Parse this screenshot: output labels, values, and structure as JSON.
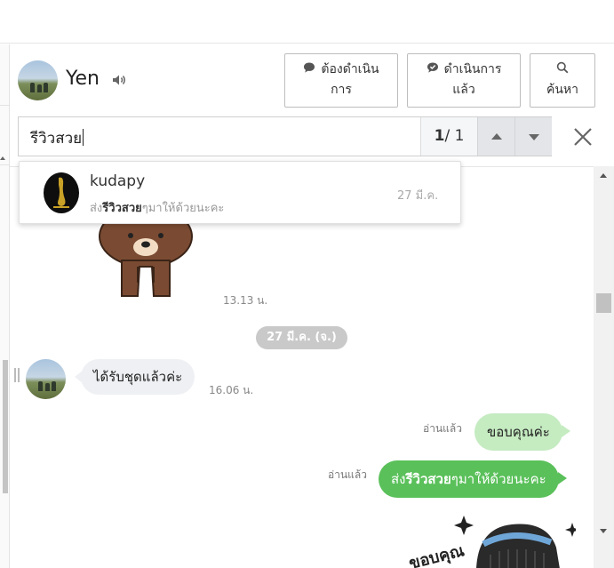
{
  "header": {
    "contact_name": "Yen",
    "buttons": {
      "todo": {
        "line1": "ต้องดำเนิน",
        "line2": "การ"
      },
      "done": {
        "line1": "ดำเนินการ",
        "line2": "แล้ว"
      },
      "search": {
        "line1": "",
        "line2": "ค้นหา"
      }
    }
  },
  "search": {
    "query": "รีวิวสวย",
    "current": "1",
    "total": "/ 1"
  },
  "search_result": {
    "name": "kudapy",
    "snippet_pre": "ส่ง",
    "snippet_match": "รีวิวสวย",
    "snippet_post": "ๆมาให้ด้วยนะคะ",
    "date": "27 มี.ค."
  },
  "chat": {
    "sticker_time": "13.13 น.",
    "date_separator": "27 มี.ค. (จ.)",
    "incoming": {
      "text": "ได้รับชุดแล้วค่ะ",
      "time": "16.06 น."
    },
    "outgoing": [
      {
        "read": "อ่านแล้ว",
        "text": "ขอบคุณค่ะ"
      },
      {
        "read": "อ่านแล้ว",
        "text_pre": "ส่ง",
        "text_match": "รีวิวสวย",
        "text_post": "ๆมาให้ด้วยนะคะ"
      }
    ],
    "sticker_caption": "ขอบคุณ"
  },
  "colors": {
    "outgoing_light": "#c5ebc1",
    "outgoing_dark": "#5ac05a",
    "incoming": "#eef0f3",
    "date_pill": "#c9c9c9"
  },
  "icons": [
    "speaker-icon",
    "speech-bubble-icon",
    "check-bubble-icon",
    "search-icon",
    "close-icon",
    "chevron-up-icon",
    "chevron-down-icon"
  ]
}
